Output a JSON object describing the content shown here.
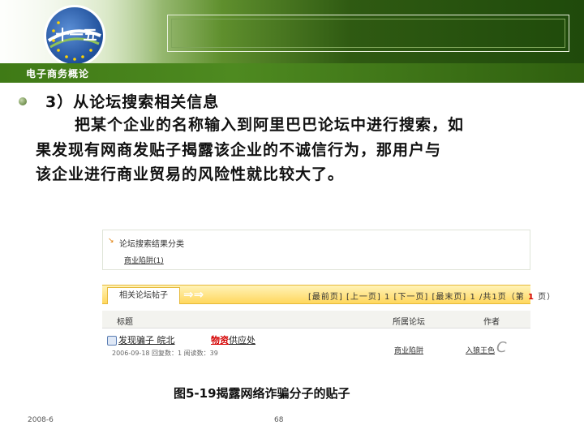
{
  "header": {
    "logo_text": "十一五",
    "course_title": "电子商务概论"
  },
  "content": {
    "heading": "3）从论坛搜索相关信息",
    "paragraph_lines": [
      "把某个企业的名称输入到阿里巴巴论坛中进行搜索，如",
      "果发现有网商发贴子揭露该企业的不诚信行为，那用户与",
      "该企业进行商业贸易的风险性就比较大了。"
    ]
  },
  "screenshot": {
    "results_title": "论坛搜索结果分类",
    "category_link": "商业陷阱",
    "category_count": "(1)",
    "tab_label": "相关论坛帖子",
    "pager_text": "[最前页] [上一页] 1 [下一页] [最末页] 1 /共1页（第",
    "pager_current": "1",
    "pager_suffix": "页）",
    "columns": {
      "title": "标题",
      "forum": "所属论坛",
      "author": "作者"
    },
    "post": {
      "title_part1": "发现骗子 皖北",
      "title_marked": "物资",
      "title_part2": "供应处",
      "meta": "2006-09-18  回复数：1  阅读数：39",
      "forum": "商业陷阱",
      "author": "入狼王色"
    }
  },
  "caption": "图5-19揭露网络诈骗分子的贴子",
  "footer": {
    "date": "2008-6",
    "page": "68"
  }
}
